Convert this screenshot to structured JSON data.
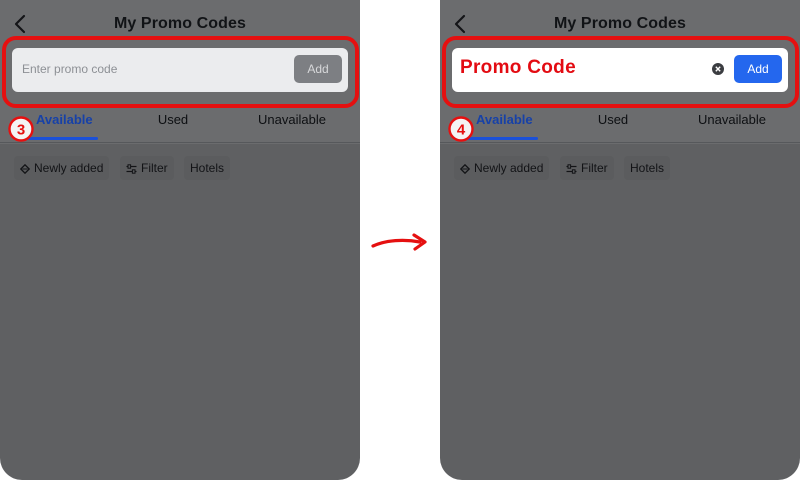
{
  "left_screen": {
    "title": "My Promo Codes",
    "search": {
      "placeholder": "Enter promo code",
      "button_label": "Add",
      "button_enabled": false
    },
    "tabs": [
      {
        "label": "Available",
        "active": true
      },
      {
        "label": "Used",
        "active": false
      },
      {
        "label": "Unavailable",
        "active": false
      }
    ],
    "chips": [
      {
        "label": "Newly added",
        "icon": "diamond-sort-icon"
      },
      {
        "label": "Filter",
        "icon": "filter-sliders-icon"
      },
      {
        "label": "Hotels",
        "icon": ""
      }
    ],
    "step_number": "3"
  },
  "right_screen": {
    "title": "My Promo Codes",
    "search": {
      "value": "Promo Code",
      "button_label": "Add",
      "button_enabled": true
    },
    "tabs": [
      {
        "label": "Available",
        "active": true
      },
      {
        "label": "Used",
        "active": false
      },
      {
        "label": "Unavailable",
        "active": false
      }
    ],
    "chips": [
      {
        "label": "Newly added",
        "icon": "diamond-sort-icon"
      },
      {
        "label": "Filter",
        "icon": "filter-sliders-icon"
      },
      {
        "label": "Hotels",
        "icon": ""
      }
    ],
    "step_number": "4"
  },
  "colors": {
    "highlight": "#e51010",
    "accent": "#2467ee",
    "overlay": "#5f6062"
  }
}
